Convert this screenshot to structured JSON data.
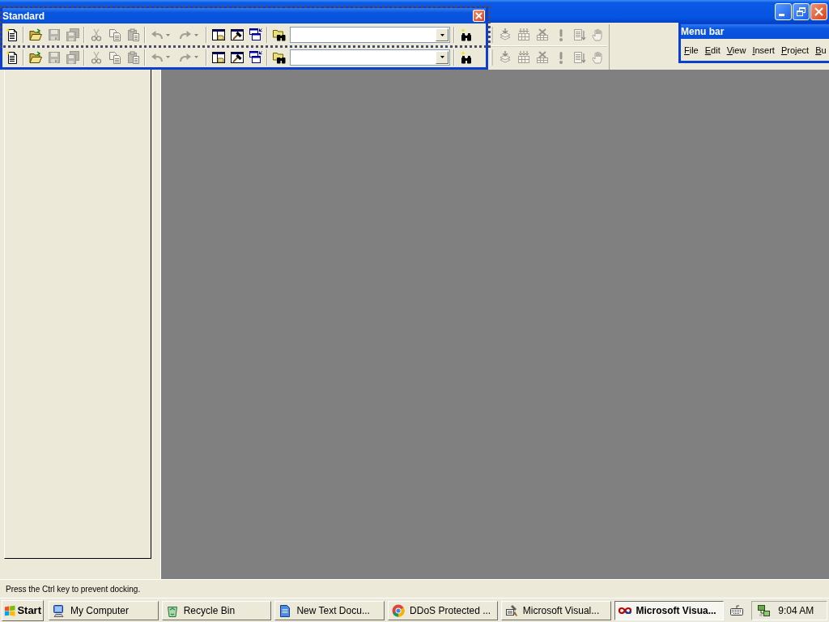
{
  "floating_toolbar": {
    "title": "Standard",
    "rows": [
      {
        "items": [
          {
            "kind": "button",
            "disabled": false
          },
          {
            "kind": "separator"
          },
          {
            "kind": "button",
            "disabled": false
          },
          {
            "kind": "button",
            "disabled": true
          },
          {
            "kind": "button",
            "disabled": true
          },
          {
            "kind": "separator"
          },
          {
            "kind": "button",
            "disabled": true
          },
          {
            "kind": "button",
            "disabled": true
          },
          {
            "kind": "button",
            "disabled": true
          },
          {
            "kind": "separator"
          },
          {
            "kind": "split",
            "disabled": true
          },
          {
            "kind": "split",
            "disabled": true
          },
          {
            "kind": "separator"
          },
          {
            "kind": "button",
            "disabled": false
          },
          {
            "kind": "button",
            "disabled": false
          },
          {
            "kind": "button",
            "disabled": false
          },
          {
            "kind": "separator"
          },
          {
            "kind": "button",
            "disabled": false
          },
          {
            "kind": "combo"
          },
          {
            "kind": "separator"
          },
          {
            "kind": "button",
            "disabled": false
          }
        ]
      },
      {
        "items": [
          {
            "kind": "button",
            "disabled": false
          },
          {
            "kind": "separator"
          },
          {
            "kind": "button",
            "disabled": false
          },
          {
            "kind": "button",
            "disabled": true
          },
          {
            "kind": "button",
            "disabled": true
          },
          {
            "kind": "separator"
          },
          {
            "kind": "button",
            "disabled": true
          },
          {
            "kind": "button",
            "disabled": true
          },
          {
            "kind": "button",
            "disabled": true
          },
          {
            "kind": "separator"
          },
          {
            "kind": "split",
            "disabled": true
          },
          {
            "kind": "split",
            "disabled": true
          },
          {
            "kind": "separator"
          },
          {
            "kind": "button",
            "disabled": false
          },
          {
            "kind": "button",
            "disabled": false
          },
          {
            "kind": "button",
            "disabled": false
          },
          {
            "kind": "separator"
          },
          {
            "kind": "button",
            "disabled": false
          },
          {
            "kind": "combo"
          },
          {
            "kind": "separator"
          },
          {
            "kind": "button",
            "disabled": false
          }
        ]
      }
    ]
  },
  "build_toolbar": {
    "rows": [
      {
        "items": [
          {
            "kind": "button",
            "disabled": true
          },
          {
            "kind": "button",
            "disabled": true
          },
          {
            "kind": "button",
            "disabled": true
          },
          {
            "kind": "button",
            "disabled": true
          },
          {
            "kind": "button",
            "disabled": true
          },
          {
            "kind": "button",
            "disabled": true
          }
        ]
      },
      {
        "items": [
          {
            "kind": "button",
            "disabled": true
          },
          {
            "kind": "button",
            "disabled": true
          },
          {
            "kind": "button",
            "disabled": true
          },
          {
            "kind": "button",
            "disabled": true
          },
          {
            "kind": "button",
            "disabled": true
          },
          {
            "kind": "button",
            "disabled": true
          }
        ]
      }
    ]
  },
  "menu_bar_window": {
    "title": "Menu bar",
    "items": [
      "File",
      "Edit",
      "View",
      "Insert",
      "Project",
      "Bu"
    ]
  },
  "status_bar": {
    "text": "Press the Ctrl key to prevent docking."
  },
  "taskbar": {
    "start": "Start",
    "tasks": [
      {
        "label": "My Computer",
        "selected": false
      },
      {
        "label": "Recycle Bin",
        "selected": false
      },
      {
        "label": "New Text Docu...",
        "selected": false
      },
      {
        "label": "DDoS Protected ...",
        "selected": false
      },
      {
        "label": "Microsoft Visual...",
        "selected": false
      },
      {
        "label": "Microsoft Visua...",
        "selected": true
      }
    ],
    "clock": "9:04 AM"
  }
}
